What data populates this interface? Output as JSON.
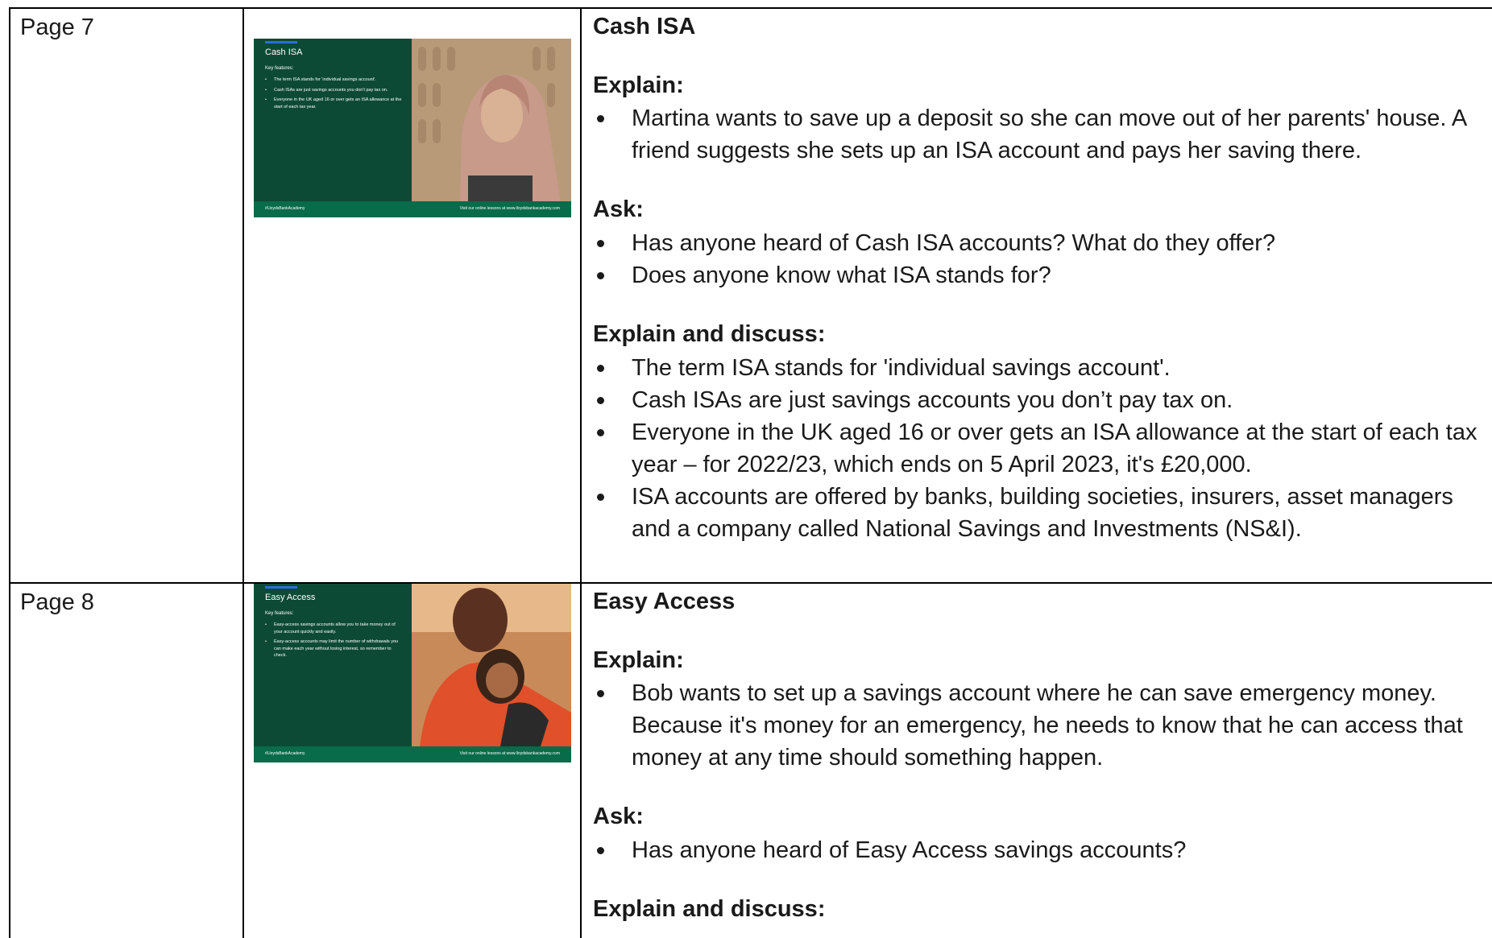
{
  "rows": [
    {
      "page_label": "Page 7",
      "slide": {
        "title": "Cash ISA",
        "key_features": "Key features:",
        "bullets": [
          "The term ISA stands for 'individual savings account'.",
          "Cash ISAs are just savings accounts you don't pay tax on.",
          "Everyone in the UK aged 16 or over gets an ISA allowance at the start of each tax year."
        ],
        "hashtag": "#LloydsBankAcademy",
        "visit": "Visit our online lessons at www.lloydsbankacademy.com",
        "photo_colors": [
          "#c9b596",
          "#8a6f5a"
        ]
      },
      "title": "Cash ISA",
      "sections": [
        {
          "heading": "Explain:",
          "bullets": [
            "Martina wants to save up a deposit so she can move out of her parents' house. A friend suggests she sets up an ISA account and pays her saving there."
          ]
        },
        {
          "heading": "Ask:",
          "bullets": [
            "Has anyone heard of Cash ISA accounts? What do they offer?",
            "Does anyone know what ISA stands for?"
          ]
        },
        {
          "heading": "Explain and discuss:",
          "bullets": [
            "The term ISA stands for 'individual savings account'.",
            "Cash ISAs are just savings accounts you don’t pay tax on.",
            "Everyone in the UK aged 16 or over gets an ISA allowance at the start of each tax year – for 2022/23, which ends on 5 April 2023, it's £20,000.",
            "ISA accounts are offered by banks, building societies, insurers, asset managers and a company called National Savings and Investments (NS&I)."
          ]
        }
      ]
    },
    {
      "page_label": "Page 8",
      "slide": {
        "title": "Easy Access",
        "key_features": "Key features:",
        "bullets": [
          "Easy-access savings accounts allow you to take money out of your account quickly and easily.",
          "Easy-access accounts may limit the number of withdrawals you can make each year without losing interest, so remember to check."
        ],
        "hashtag": "#LloydsBankAcademy",
        "visit": "Visit our online lessons at www.lloydsbankacademy.com",
        "photo_colors": [
          "#d9542b",
          "#5a2a1a"
        ]
      },
      "title": "Easy Access",
      "sections": [
        {
          "heading": "Explain:",
          "bullets": [
            "Bob wants to set up a savings account where he can save emergency money. Because it's money for an emergency, he needs to know that he can access that money at any time should something happen."
          ]
        },
        {
          "heading": "Ask:",
          "bullets": [
            "Has anyone heard of Easy Access savings accounts?"
          ]
        },
        {
          "heading": "Explain and discuss:",
          "bullets": []
        }
      ]
    }
  ]
}
